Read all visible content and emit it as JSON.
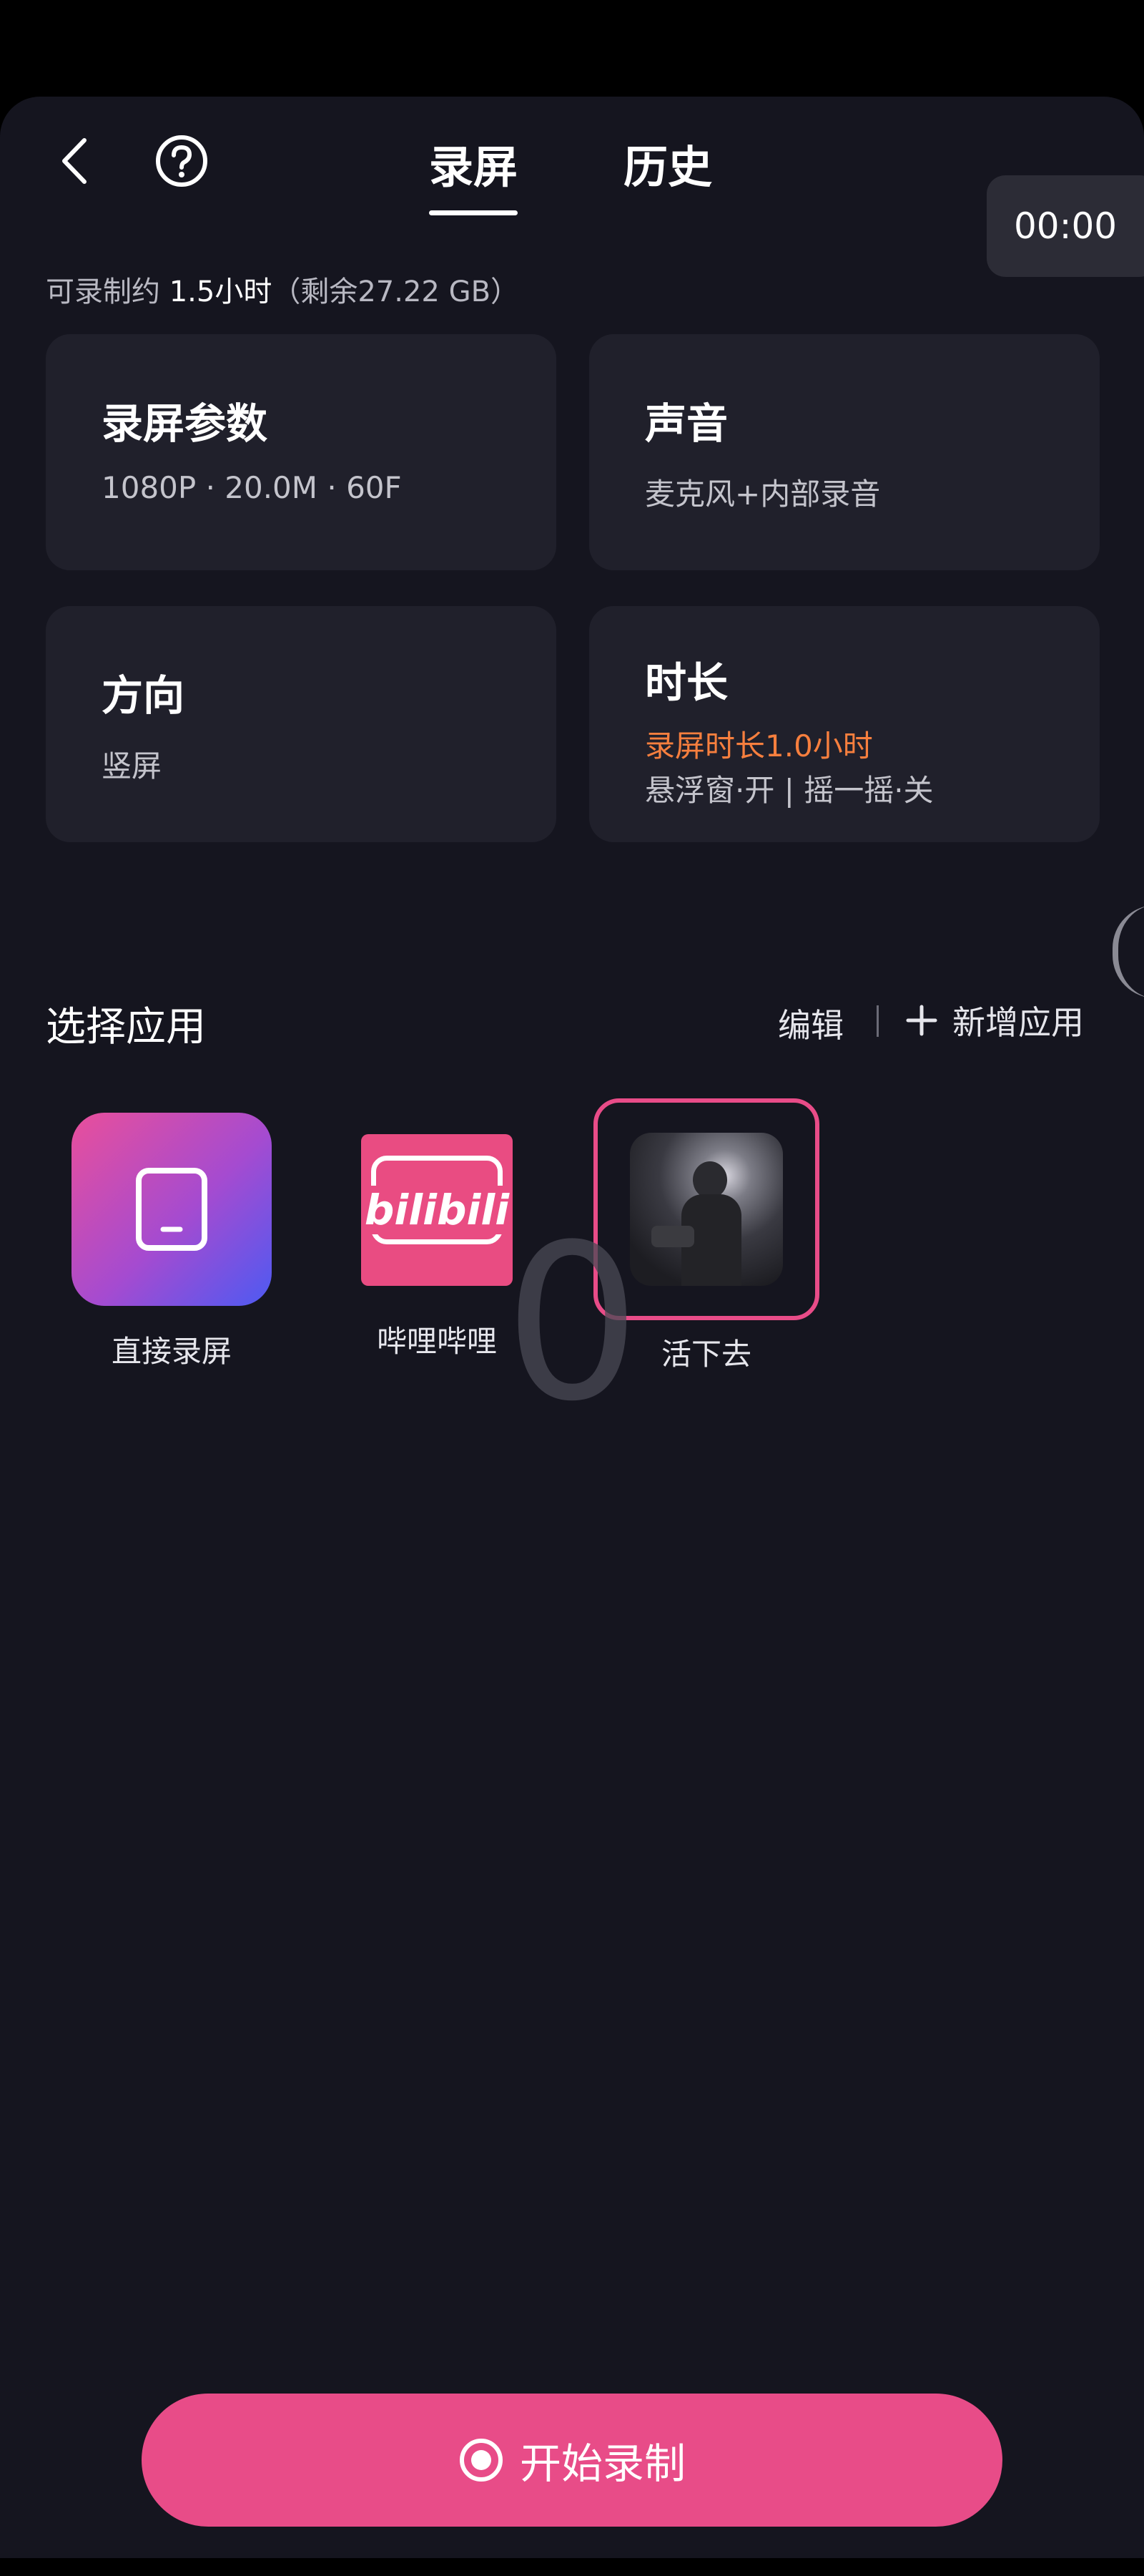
{
  "header": {
    "tabs": [
      {
        "label": "录屏",
        "active": true
      },
      {
        "label": "历史",
        "active": false
      }
    ],
    "timer": "00:00"
  },
  "storage": {
    "prefix": "可录制约 ",
    "duration": "1.5小时",
    "suffix": "（剩余27.22 GB）"
  },
  "cards": {
    "params": {
      "title": "录屏参数",
      "value": "1080P · 20.0M · 60F"
    },
    "sound": {
      "title": "声音",
      "value": "麦克风+内部录音"
    },
    "orientation": {
      "title": "方向",
      "value": "竖屏"
    },
    "duration": {
      "title": "时长",
      "highlight": "录屏时长1.0小时",
      "value": "悬浮窗·开 | 摇一摇·关"
    }
  },
  "apps_section": {
    "title": "选择应用",
    "edit_label": "编辑",
    "add_label": "新增应用",
    "apps": [
      {
        "label": "直接录屏"
      },
      {
        "label": "哔哩哔哩",
        "logo_text": "bilibili"
      },
      {
        "label": "活下去",
        "selected": true
      }
    ]
  },
  "overlay_digit": "0",
  "start_button": {
    "label": "开始录制"
  },
  "colors": {
    "background": "#15151f",
    "card": "#20202b",
    "accent_pink": "#e84c88",
    "highlight_orange": "#f77f3e"
  }
}
